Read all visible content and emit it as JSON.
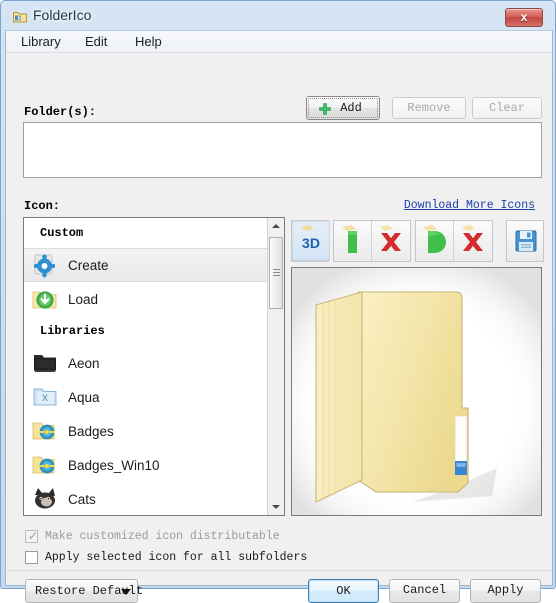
{
  "window": {
    "title": "FolderIco",
    "icon": "folder-app-icon",
    "close_label": "x",
    "accent_blue": "#c3d9ee",
    "close_red": "#c2453f"
  },
  "menubar": {
    "items": [
      {
        "label": "Library",
        "name": "menu-library"
      },
      {
        "label": "Edit",
        "name": "menu-edit"
      },
      {
        "label": "Help",
        "name": "menu-help"
      }
    ]
  },
  "folders_section": {
    "label": "Folder(s):",
    "add_label": "Add",
    "add_icon": "green-plus-icon",
    "remove_label": "Remove",
    "remove_enabled": false,
    "clear_label": "Clear",
    "clear_enabled": false,
    "list_value": "",
    "list_placeholder": ""
  },
  "icon_section": {
    "label": "Icon:",
    "download_link": "Download More Icons",
    "link_color": "#1a3ea8"
  },
  "icon_list": {
    "groups": [
      {
        "header": "Custom",
        "items": [
          {
            "label": "Create",
            "icon": "blue-gear-icon",
            "selected": true
          },
          {
            "label": "Load",
            "icon": "green-download-icon",
            "selected": false
          }
        ]
      },
      {
        "header": "Libraries",
        "items": [
          {
            "label": "Aeon",
            "icon": "dark-folder-icon",
            "selected": false
          },
          {
            "label": "Aqua",
            "icon": "aqua-folder-icon",
            "selected": false
          },
          {
            "label": "Badges",
            "icon": "badges-folder-icon",
            "selected": false
          },
          {
            "label": "Badges_Win10",
            "icon": "badges-win10-folder-icon",
            "selected": false
          },
          {
            "label": "Cats",
            "icon": "cat-face-icon",
            "selected": false
          }
        ]
      }
    ],
    "scroll_position": "near-top"
  },
  "icon_toolbar": {
    "groups": [
      {
        "name": "three-d-group",
        "buttons": [
          {
            "name": "three-d-toggle-button",
            "icon": "3d-icon",
            "label": "3D",
            "pressed": true
          }
        ]
      },
      {
        "name": "shape-group-1",
        "buttons": [
          {
            "name": "apply-green-shape-button",
            "icon": "green-bar-icon",
            "label": "",
            "pressed": false
          },
          {
            "name": "remove-green-shape-button",
            "icon": "red-x-icon",
            "label": "",
            "pressed": false
          }
        ]
      },
      {
        "name": "shape-group-2",
        "buttons": [
          {
            "name": "apply-green-disc-button",
            "icon": "green-disc-icon",
            "label": "",
            "pressed": false
          },
          {
            "name": "remove-green-disc-button",
            "icon": "red-x-icon",
            "label": "",
            "pressed": false
          }
        ]
      },
      {
        "name": "save-group",
        "buttons": [
          {
            "name": "save-icon-button",
            "icon": "floppy-save-icon",
            "label": "",
            "pressed": false
          }
        ]
      }
    ]
  },
  "preview": {
    "icon_name": "open-folder-preview",
    "folder_color": "#f2e6ac"
  },
  "options": {
    "distributable": {
      "label": "Make customized icon distributable",
      "checked": true,
      "enabled": false,
      "tick": "✓"
    },
    "subfolders": {
      "label": "Apply selected icon for all subfolders",
      "checked": false,
      "enabled": true,
      "tick": ""
    }
  },
  "footer": {
    "restore_label": "Restore Default",
    "ok_label": "OK",
    "cancel_label": "Cancel",
    "apply_label": "Apply"
  }
}
